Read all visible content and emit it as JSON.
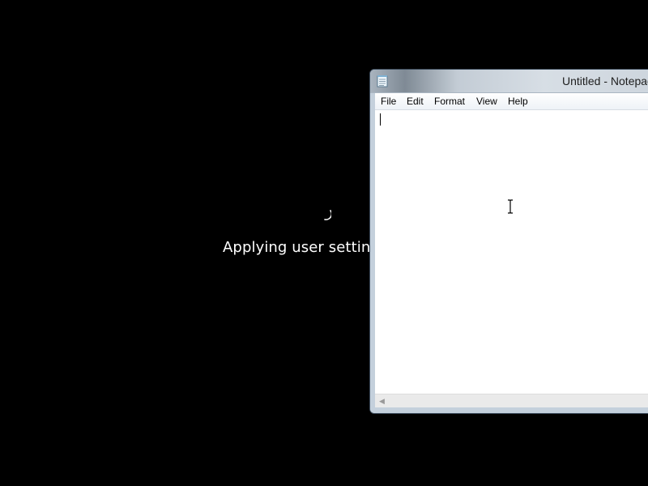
{
  "desktop": {
    "status_text": "Applying user settings",
    "spinner_icon": "loading-spinner-icon"
  },
  "notepad": {
    "title": "Untitled - Notepad",
    "app_icon": "notepad-icon",
    "menu": [
      {
        "label": "File"
      },
      {
        "label": "Edit"
      },
      {
        "label": "Format"
      },
      {
        "label": "View"
      },
      {
        "label": "Help"
      }
    ],
    "content": "",
    "cursor_icon": "ibeam-cursor-icon",
    "scroll_left_icon": "scroll-left-arrow-icon"
  },
  "colors": {
    "background": "#000000",
    "status_text": "#ffffff",
    "window_frame": "#c4d0dc",
    "editor_bg": "#ffffff"
  }
}
